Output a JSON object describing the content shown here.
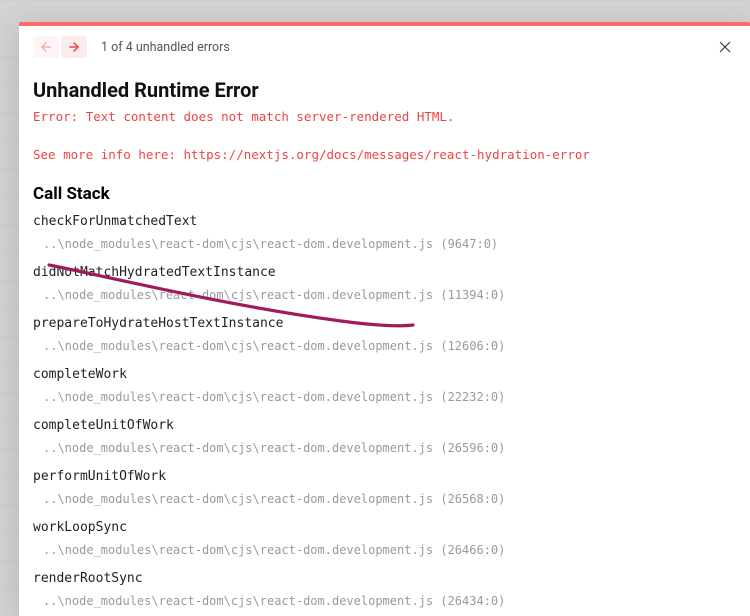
{
  "header": {
    "counter": "1 of 4 unhandled errors"
  },
  "title": "Unhandled Runtime Error",
  "error_prefix": "Error: ",
  "error_message": "Text content does not match server-rendered HTML.",
  "info_prefix": "See more info here: ",
  "info_link": "https://nextjs.org/docs/messages/react-hydration-error",
  "call_stack_heading": "Call Stack",
  "frames": [
    {
      "fn": "checkForUnmatchedText",
      "loc": "..\\node_modules\\react-dom\\cjs\\react-dom.development.js (9647:0)"
    },
    {
      "fn": "didNotMatchHydratedTextInstance",
      "loc": "..\\node_modules\\react-dom\\cjs\\react-dom.development.js (11394:0)"
    },
    {
      "fn": "prepareToHydrateHostTextInstance",
      "loc": "..\\node_modules\\react-dom\\cjs\\react-dom.development.js (12606:0)"
    },
    {
      "fn": "completeWork",
      "loc": "..\\node_modules\\react-dom\\cjs\\react-dom.development.js (22232:0)"
    },
    {
      "fn": "completeUnitOfWork",
      "loc": "..\\node_modules\\react-dom\\cjs\\react-dom.development.js (26596:0)"
    },
    {
      "fn": "performUnitOfWork",
      "loc": "..\\node_modules\\react-dom\\cjs\\react-dom.development.js (26568:0)"
    },
    {
      "fn": "workLoopSync",
      "loc": "..\\node_modules\\react-dom\\cjs\\react-dom.development.js (26466:0)"
    },
    {
      "fn": "renderRootSync",
      "loc": "..\\node_modules\\react-dom\\cjs\\react-dom.development.js (26434:0)"
    }
  ],
  "colors": {
    "accent": "#ff6b6b",
    "error_text": "#e44",
    "annotation": "#a01b5b"
  }
}
